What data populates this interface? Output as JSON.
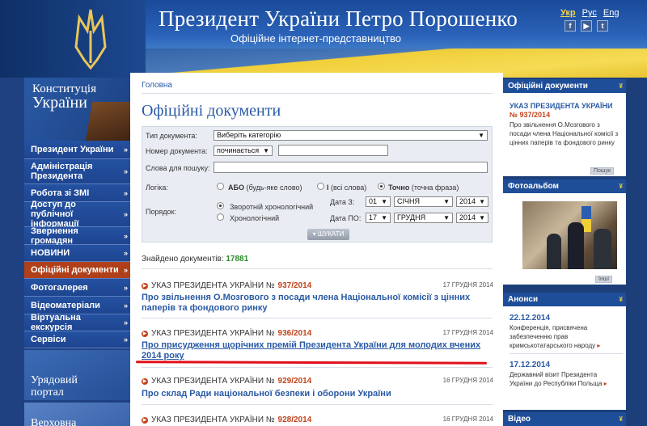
{
  "header": {
    "title": "Президент України Петро Порошенко",
    "subtitle": "Офіційне інтернет-представництво",
    "languages": [
      {
        "label": "Укр",
        "active": true
      },
      {
        "label": "Рус",
        "active": false
      },
      {
        "label": "Eng",
        "active": false
      }
    ],
    "socials": [
      "f",
      "▶",
      "t"
    ]
  },
  "sidebar": {
    "constitution_line1": "Конституція",
    "constitution_line2": "України",
    "items": [
      {
        "label": "Президент України",
        "active": false
      },
      {
        "label": "Адміністрація Президента",
        "active": false
      },
      {
        "label": "Робота зі ЗМІ",
        "active": false
      },
      {
        "label": "Доступ до публічної інформації",
        "active": false
      },
      {
        "label": "Звернення громадян",
        "active": false
      },
      {
        "label": "НОВИНИ",
        "active": false
      },
      {
        "label": "Офіційні документи",
        "active": true
      },
      {
        "label": "Фотогалерея",
        "active": false
      },
      {
        "label": "Відеоматеріали",
        "active": false
      },
      {
        "label": "Віртуальна екскурсія",
        "active": false
      },
      {
        "label": "Сервіси",
        "active": false
      }
    ],
    "portal_line1": "Урядовий",
    "portal_line2": "портал",
    "rada_label": "Верховна"
  },
  "main": {
    "breadcrumb": "Головна",
    "title": "Офіційні документи",
    "search": {
      "doc_type_label": "Тип документа:",
      "doc_type_value": "Виберіть категорію",
      "doc_number_label": "Номер документа:",
      "doc_number_mode": "починається",
      "doc_number_value": "",
      "keywords_label": "Слова для пошуку:",
      "keywords_value": "",
      "logic_label": "Логіка:",
      "logic_options": [
        {
          "bold": "АБО",
          "rest": " (будь-яке слово)",
          "selected": false
        },
        {
          "bold": "І",
          "rest": " (всі слова)",
          "selected": false
        },
        {
          "bold": "Точно",
          "rest": " (точна фраза)",
          "selected": true
        }
      ],
      "order_label": "Порядок:",
      "order_options": [
        {
          "label": "Зворотній хронологічний",
          "selected": true
        },
        {
          "label": "Хронологічний",
          "selected": false
        }
      ],
      "date_from_label": "Дата З:",
      "date_from": {
        "day": "01",
        "month": "СІЧНЯ",
        "year": "2014"
      },
      "date_to_label": "Дата ПО:",
      "date_to": {
        "day": "17",
        "month": "ГРУДНЯ",
        "year": "2014"
      },
      "submit_label": "ШУКАТИ"
    },
    "found_label": "Знайдено документів:",
    "found_count": "17881",
    "documents": [
      {
        "type": "УКАЗ ПРЕЗИДЕНТА УКРАЇНИ №",
        "number": "937/2014",
        "date": "17 ГРУДНЯ 2014",
        "title": "Про звільнення О.Мозгового з посади члена Національної комісії з цінних паперів та фондового ринку",
        "underline": false
      },
      {
        "type": "УКАЗ ПРЕЗИДЕНТА УКРАЇНИ №",
        "number": "936/2014",
        "date": "17 ГРУДНЯ 2014",
        "title": "Про присудження щорічних премій Президента України для молодих вчених 2014 року",
        "underline": true
      },
      {
        "type": "УКАЗ ПРЕЗИДЕНТА УКРАЇНИ №",
        "number": "929/2014",
        "date": "16 ГРУДНЯ 2014",
        "title": "Про склад Ради національної безпеки і оборони України",
        "underline": false
      },
      {
        "type": "УКАЗ ПРЕЗИДЕНТА УКРАЇНИ №",
        "number": "928/2014",
        "date": "16 ГРУДНЯ 2014",
        "title": "",
        "underline": false
      }
    ]
  },
  "right": {
    "official_docs_title": "Офіційні документи",
    "official_doc_type": "УКАЗ ПРЕЗИДЕНТА УКРАЇНИ",
    "official_doc_number": "№ 937/2014",
    "official_doc_text": "Про звільнення О.Мозгового з посади члена Національної комісії з цінних паперів та фондового ринку",
    "official_more": "Пошук",
    "photo_title": "Фотоальбом",
    "photo_more": "Інші",
    "announce_title": "Анонси",
    "announcements": [
      {
        "date": "22.12.2014",
        "text": "Конференція, присвячена забезпеченню прав кримськотатарського народу"
      },
      {
        "date": "17.12.2014",
        "text": "Державний візит Президента України до Республіки Польща"
      }
    ],
    "video_title": "Відео"
  },
  "colors": {
    "accent": "#2a5aa5",
    "active_nav": "#b0401a",
    "doc_number": "#c0431c",
    "count": "#2a8a2a",
    "highlight_line": "#e0101c"
  }
}
